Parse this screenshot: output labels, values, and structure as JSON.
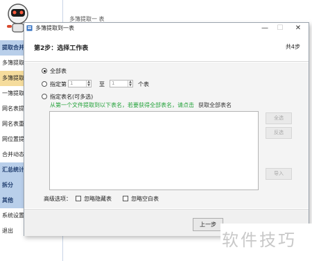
{
  "background_app": {
    "tab_label": "多簿提取一 表",
    "sidebar": [
      {
        "label": "提取合并",
        "kind": "group"
      },
      {
        "label": "多簿提取",
        "kind": "item"
      },
      {
        "label": "多簿提取",
        "kind": "active"
      },
      {
        "label": "一簿提取",
        "kind": "item"
      },
      {
        "label": "网名表提",
        "kind": "item"
      },
      {
        "label": "网名表重",
        "kind": "item"
      },
      {
        "label": "网位置提",
        "kind": "item"
      },
      {
        "label": "合并动态",
        "kind": "item"
      },
      {
        "label": "汇总统计",
        "kind": "group"
      },
      {
        "label": "拆分",
        "kind": "group"
      },
      {
        "label": "其他",
        "kind": "group"
      },
      {
        "label": "系统设置",
        "kind": "item"
      },
      {
        "label": "退出",
        "kind": "item"
      }
    ],
    "watermark": "软件技巧"
  },
  "dialog": {
    "title": "多簿提取到一表",
    "minimize": "—",
    "maximize": "☐",
    "close": "✕",
    "step_title": "第2步：选择工作表",
    "step_total": "共4步",
    "options": {
      "all_sheets": "全部表",
      "range_prefix": "指定第",
      "range_from_value": "1",
      "range_mid": "至",
      "range_to_value": "1",
      "range_suffix": "个表",
      "named_sheets": "指定表名(可多选)",
      "hint": "从第一个文件提取到以下表名，若要获得全部表名，请点击",
      "get_all_link": "获取全部表名"
    },
    "side_buttons": {
      "select_all": "全选",
      "invert": "反选",
      "import": "导入"
    },
    "advanced": {
      "label": "高级选项：",
      "ignore_hidden": "忽略隐藏表",
      "ignore_blank": "忽略空白表"
    },
    "footer": {
      "prev_button": "上一步"
    }
  }
}
